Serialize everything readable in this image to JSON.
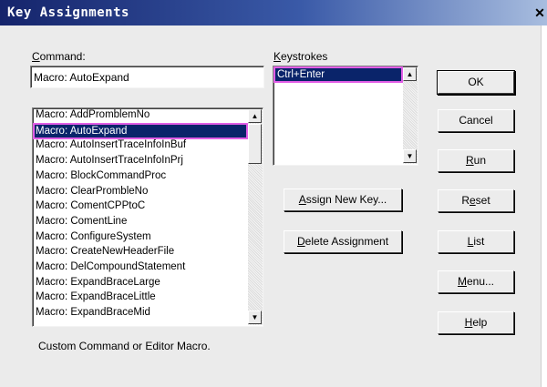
{
  "window": {
    "title": "Key Assignments",
    "close_glyph": "✕"
  },
  "command": {
    "label_prefix": "",
    "label_accel": "C",
    "label_rest": "ommand:",
    "value": "Macro: AutoExpand",
    "list": [
      "Macro: AddPromblemNo",
      "Macro: AutoExpand",
      "Macro: AutoInsertTraceInfoInBuf",
      "Macro: AutoInsertTraceInfoInPrj",
      "Macro: BlockCommandProc",
      "Macro: ClearPrombleNo",
      "Macro: ComentCPPtoC",
      "Macro: ComentLine",
      "Macro: ConfigureSystem",
      "Macro: CreateNewHeaderFile",
      "Macro: DelCompoundStatement",
      "Macro: ExpandBraceLarge",
      "Macro: ExpandBraceLittle",
      "Macro: ExpandBraceMid"
    ],
    "selected_index": 1
  },
  "keystrokes": {
    "label_accel": "K",
    "label_rest": "eystrokes",
    "items": [
      "Ctrl+Enter"
    ]
  },
  "buttons": {
    "ok": "OK",
    "cancel": "Cancel",
    "run": {
      "accel": "R",
      "rest": "un"
    },
    "reset": {
      "pre": "R",
      "accel": "e",
      "rest": "set"
    },
    "list": {
      "accel": "L",
      "rest": "ist"
    },
    "menu": {
      "accel": "M",
      "rest": "enu..."
    },
    "help": {
      "accel": "H",
      "rest": "elp"
    },
    "assign_new_key": {
      "accel": "A",
      "rest": "ssign New Key..."
    },
    "delete_assignment": {
      "accel": "D",
      "rest": "elete Assignment"
    }
  },
  "description": "Custom Command or Editor Macro.",
  "scroll_glyphs": {
    "up": "▲",
    "down": "▼"
  }
}
